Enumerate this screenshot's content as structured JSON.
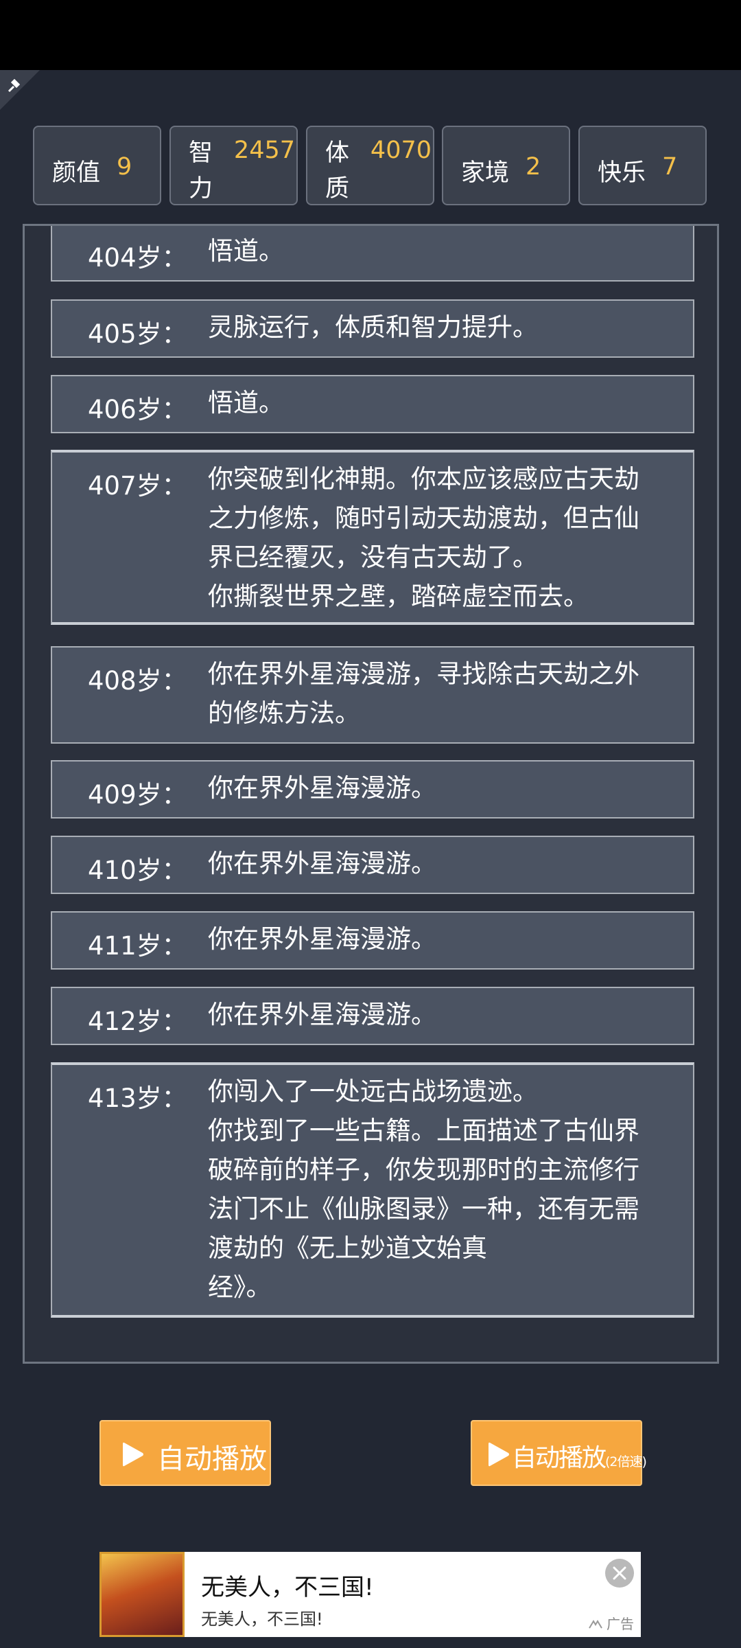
{
  "stats": [
    {
      "label": "颜值",
      "value": "9"
    },
    {
      "label": "智力",
      "value": "2457"
    },
    {
      "label": "体质",
      "value": "4070"
    },
    {
      "label": "家境",
      "value": "2"
    },
    {
      "label": "快乐",
      "value": "7"
    }
  ],
  "log": [
    {
      "age": "404岁：",
      "text": "悟道。"
    },
    {
      "age": "405岁：",
      "text": "灵脉运行，体质和智力提升。"
    },
    {
      "age": "406岁：",
      "text": "悟道。"
    },
    {
      "age": "407岁：",
      "text": "你突破到化神期。你本应该感应古天劫之力修炼，随时引动天劫渡劫，但古仙界已经覆灭，没有古天劫了。\n你撕裂世界之壁，踏碎虚空而去。"
    },
    {
      "age": "408岁：",
      "text": "你在界外星海漫游，寻找除古天劫之外的修炼方法。"
    },
    {
      "age": "409岁：",
      "text": "你在界外星海漫游。"
    },
    {
      "age": "410岁：",
      "text": "你在界外星海漫游。"
    },
    {
      "age": "411岁：",
      "text": "你在界外星海漫游。"
    },
    {
      "age": "412岁：",
      "text": "你在界外星海漫游。"
    },
    {
      "age": "413岁：",
      "text": "你闯入了一处远古战场遗迹。\n你找到了一些古籍。上面描述了古仙界破碎前的样子，你发现那时的主流修行法门不止《仙脉图录》一种，还有无需渡劫的《无上妙道文始真\n经》。"
    }
  ],
  "buttons": {
    "auto_play": "自动播放",
    "auto_play_fast": "自动播放",
    "auto_play_fast_suffix": "(2倍速)"
  },
  "ad": {
    "title": "无美人，不三国!",
    "subtitle": "无美人，不三国!",
    "tag": "广告"
  },
  "colors": {
    "background": "#222733",
    "accent_value": "#f4c04a",
    "button": "#f6a73f"
  }
}
